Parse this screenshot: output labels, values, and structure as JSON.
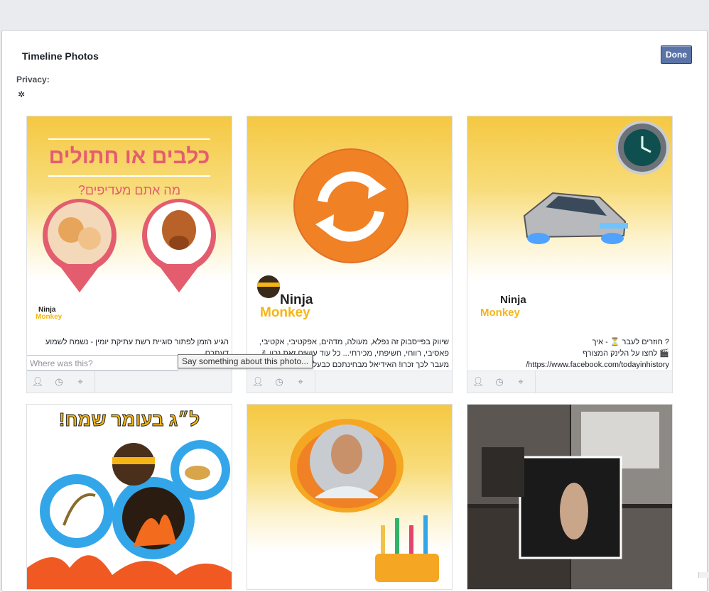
{
  "dialog": {
    "title": "Timeline Photos",
    "done_label": "Done",
    "privacy_label": "Privacy:",
    "privacy_icon": "gear-icon"
  },
  "photos": [
    {
      "image": {
        "heading": "כלבים או חתולים",
        "subheading": "מה אתם מעדיפים?",
        "logo_line1": "Ninja",
        "logo_line2": "Monkey"
      },
      "caption": "הגיע הזמן לפתור סוגיית רשת עתיקת יומין - נשמח לשמוע דעתכם",
      "where_placeholder": "Where was this?"
    },
    {
      "image": {
        "logo_line1": "Ninja",
        "logo_line2": "Monkey"
      },
      "caption": "שיווק בפייסבוק זה נפלא, מעולה, מדהים, אפקטיבי, אקטיבי, פאסיבי, רווחי, חשיפתי, מכירתי... כל עוד עושים זאת נכון ✌\nמעבר לכך זכרו! האידיאל מבחינתכם כבעלי עסקים, לפעול בכמה זירות דיגיטל, להגדיל את המוניטין..."
    },
    {
      "image": {
        "logo_line1": "Ninja",
        "logo_line2": "Monkey"
      },
      "caption": "? חוזרים לעבר ⏳ - איך\n🎬 לחצו על הלינק המצורף\nhttps://www.facebook.com/todayinhistory/\nותקבלו את הניוזפיד שלכם כפי שהוא היה באותו היום רק"
    },
    {
      "image": {
        "heading": "ל״ג בעומר שמח!"
      }
    },
    {
      "image": {}
    },
    {
      "image": {}
    }
  ],
  "tooltip": "Say something about this photo..."
}
